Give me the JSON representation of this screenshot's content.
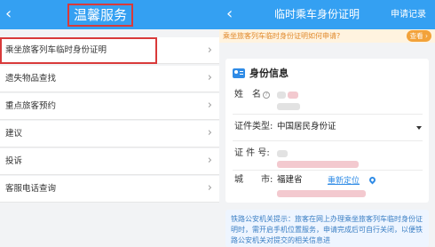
{
  "left_screen": {
    "back_icon": "back-chevron-icon",
    "title": "温馨服务",
    "menu": [
      {
        "label": "乘坐旅客列车临时身份证明",
        "icon": "chevron-right-icon",
        "highlighted": true
      },
      {
        "label": "遗失物品查找",
        "icon": "chevron-right-icon"
      },
      {
        "label": "重点旅客预约",
        "icon": "chevron-right-icon"
      },
      {
        "label": "建议",
        "icon": "chevron-right-icon"
      },
      {
        "label": "投诉",
        "icon": "chevron-right-icon"
      },
      {
        "label": "客服电话查询",
        "icon": "chevron-right-icon"
      }
    ],
    "chevron_glyph": "›"
  },
  "right_screen": {
    "back_icon": "back-chevron-icon",
    "title": "临时乘车身份证明",
    "apply_records": "申请记录",
    "notice": {
      "text": "乘坐旅客列车临时身份证明如何申请?",
      "badge": "查看 ›"
    },
    "identity": {
      "section_title": "身份信息",
      "name_label": "姓　名",
      "id_type_label": "证件类型:",
      "id_type_value": "中国居民身份证",
      "id_number_label": "证 件 号:",
      "city_label": "城　　市:",
      "city_value": "福建省",
      "relocate": "重新定位"
    },
    "tips": "铁路公安机关提示：旅客在网上办理乘坐旅客列车临时身份证明时，需开启手机位置服务，申请完成后可自行关闭，以便铁路公安机关对提交的相关信息进"
  },
  "colors": {
    "header_blue": "#34a0f2",
    "highlight_red": "#d93a3a",
    "notice_orange": "#e08a2c",
    "link_blue": "#2f8be6"
  }
}
